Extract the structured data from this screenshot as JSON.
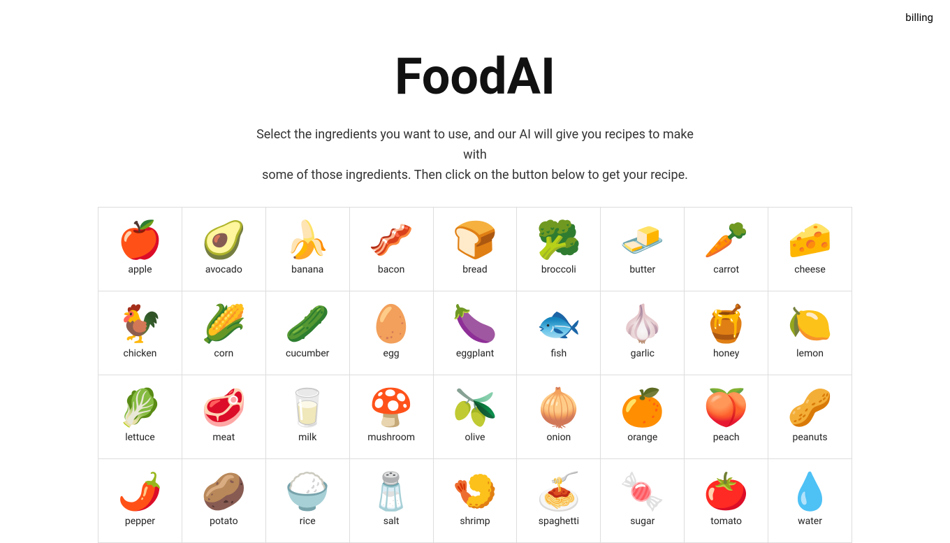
{
  "nav": {
    "billing_label": "billing"
  },
  "header": {
    "title": "FoodAI",
    "subtitle_line1": "Select the ingredients you want to use, and our AI will give you recipes to make with",
    "subtitle_line2": "some of those ingredients. Then click on the button below to get your recipe."
  },
  "ingredients": [
    {
      "id": "apple",
      "label": "apple",
      "emoji": "🍎"
    },
    {
      "id": "avocado",
      "label": "avocado",
      "emoji": "🥑"
    },
    {
      "id": "banana",
      "label": "banana",
      "emoji": "🍌"
    },
    {
      "id": "bacon",
      "label": "bacon",
      "emoji": "🥓"
    },
    {
      "id": "bread",
      "label": "bread",
      "emoji": "🍞"
    },
    {
      "id": "broccoli",
      "label": "broccoli",
      "emoji": "🥦"
    },
    {
      "id": "butter",
      "label": "butter",
      "emoji": "🧈"
    },
    {
      "id": "carrot",
      "label": "carrot",
      "emoji": "🥕"
    },
    {
      "id": "cheese",
      "label": "cheese",
      "emoji": "🧀"
    },
    {
      "id": "chicken",
      "label": "chicken",
      "emoji": "🐓"
    },
    {
      "id": "corn",
      "label": "corn",
      "emoji": "🌽"
    },
    {
      "id": "cucumber",
      "label": "cucumber",
      "emoji": "🥒"
    },
    {
      "id": "egg",
      "label": "egg",
      "emoji": "🥚"
    },
    {
      "id": "eggplant",
      "label": "eggplant",
      "emoji": "🍆"
    },
    {
      "id": "fish",
      "label": "fish",
      "emoji": "🐟"
    },
    {
      "id": "garlic",
      "label": "garlic",
      "emoji": "🧄"
    },
    {
      "id": "honey",
      "label": "honey",
      "emoji": "🍯"
    },
    {
      "id": "lemon",
      "label": "lemon",
      "emoji": "🍋"
    },
    {
      "id": "lettuce",
      "label": "lettuce",
      "emoji": "🥬"
    },
    {
      "id": "meat",
      "label": "meat",
      "emoji": "🥩"
    },
    {
      "id": "milk",
      "label": "milk",
      "emoji": "🥛"
    },
    {
      "id": "mushroom",
      "label": "mushroom",
      "emoji": "🍄"
    },
    {
      "id": "olive",
      "label": "olive",
      "emoji": "🫒"
    },
    {
      "id": "onion",
      "label": "onion",
      "emoji": "🧅"
    },
    {
      "id": "orange",
      "label": "orange",
      "emoji": "🍊"
    },
    {
      "id": "peach",
      "label": "peach",
      "emoji": "🍑"
    },
    {
      "id": "peanuts",
      "label": "peanuts",
      "emoji": "🥜"
    },
    {
      "id": "pepper",
      "label": "pepper",
      "emoji": "🌶️"
    },
    {
      "id": "potato",
      "label": "potato",
      "emoji": "🥔"
    },
    {
      "id": "rice",
      "label": "rice",
      "emoji": "🍚"
    },
    {
      "id": "salt",
      "label": "salt",
      "emoji": "🧂"
    },
    {
      "id": "shrimp",
      "label": "shrimp",
      "emoji": "🍤"
    },
    {
      "id": "spaghetti",
      "label": "spaghetti",
      "emoji": "🍝"
    },
    {
      "id": "sugar",
      "label": "sugar",
      "emoji": "🍬"
    },
    {
      "id": "tomato",
      "label": "tomato",
      "emoji": "🍅"
    },
    {
      "id": "water",
      "label": "water",
      "emoji": "💧"
    }
  ]
}
